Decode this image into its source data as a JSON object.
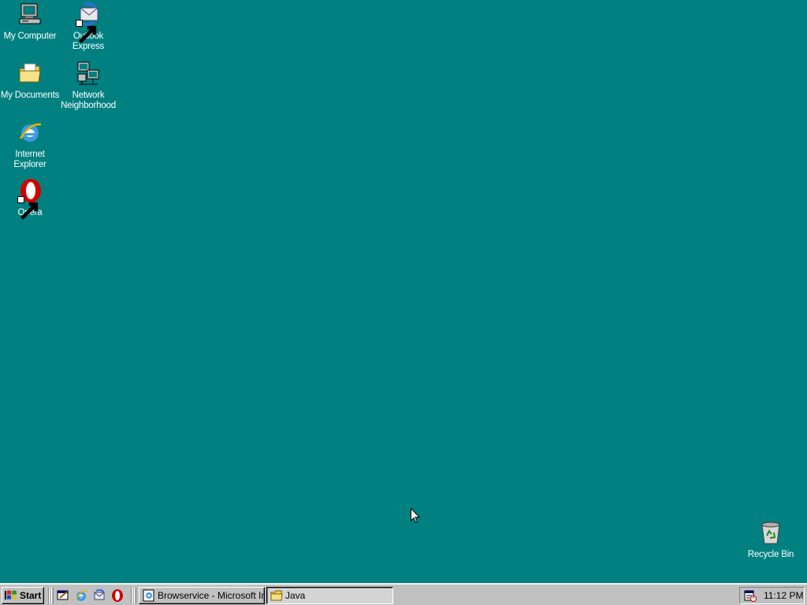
{
  "desktop": {
    "background": "#008080",
    "icons": [
      {
        "id": "my-computer",
        "label": "My Computer",
        "icon": "computer-icon"
      },
      {
        "id": "outlook-express",
        "label": "Outlook\nExpress",
        "icon": "outlook-express-icon",
        "shortcut": true
      },
      {
        "id": "my-documents",
        "label": "My Documents",
        "icon": "folder-icon"
      },
      {
        "id": "network-neighborhood",
        "label": "Network\nNeighborhood",
        "icon": "network-icon"
      },
      {
        "id": "internet-explorer",
        "label": "Internet\nExplorer",
        "icon": "ie-icon"
      },
      {
        "id": "opera",
        "label": "Opera",
        "icon": "opera-icon",
        "shortcut": true
      },
      {
        "id": "recycle-bin",
        "label": "Recycle Bin",
        "icon": "recycle-bin-icon"
      }
    ]
  },
  "taskbar": {
    "start_label": "Start",
    "quick_launch": [
      "show-desktop-icon",
      "ie-icon",
      "outlook-express-icon",
      "opera-icon"
    ],
    "tasks": [
      {
        "label": "Browservice - Microsoft Int...",
        "icon": "ie-page-icon",
        "pressed": false
      },
      {
        "label": "Java",
        "icon": "folder-icon",
        "pressed": true
      }
    ],
    "tray": {
      "icon": "task-scheduler-icon",
      "clock": "11:12 PM"
    }
  }
}
